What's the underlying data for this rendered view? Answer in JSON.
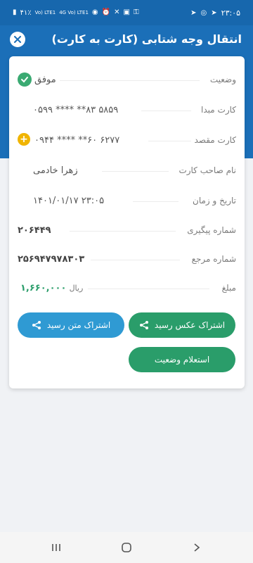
{
  "status_bar": {
    "time": "۲۳:۰۵",
    "battery": "۴۱٪",
    "network_1": "Vo) LTE1",
    "network_2": "4G Vo) LTE1"
  },
  "header": {
    "title": "انتقال وجه شتابی (کارت به کارت)"
  },
  "receipt": {
    "rows": [
      {
        "label": "وضعیت",
        "value": "موفق"
      },
      {
        "label": "کارت مبدا",
        "value": "۵۸۵۹ ۸۳** **** ۰۵۹۹"
      },
      {
        "label": "کارت مقصد",
        "value": "۶۲۷۷ ۶۰** **** ۰۹۴۴"
      },
      {
        "label": "نام صاحب کارت",
        "value": "زهرا خادمی"
      },
      {
        "label": "تاریخ و زمان",
        "value": "۱۴۰۱/۰۱/۱۷  ۲۳:۰۵"
      },
      {
        "label": "شماره پیگیری",
        "value": "۲۰۶۴۴۹"
      },
      {
        "label": "شماره مرجع",
        "value": "۲۵۶۹۴۷۹۷۸۳۰۳"
      },
      {
        "label": "مبلغ",
        "amount": "۱,۶۶۰,۰۰۰",
        "currency": "ریال"
      }
    ]
  },
  "buttons": {
    "share_image": "اشتراک عکس رسید",
    "share_text": "اشتراک متن رسید",
    "inquiry": "استعلام وضعیت"
  },
  "colors": {
    "header": "#1b6fb8",
    "success": "#3aaa72",
    "green_button": "#2a9d6a",
    "blue_button": "#2f9ad3",
    "amount": "#2a9d6a",
    "add": "#f0b400"
  }
}
